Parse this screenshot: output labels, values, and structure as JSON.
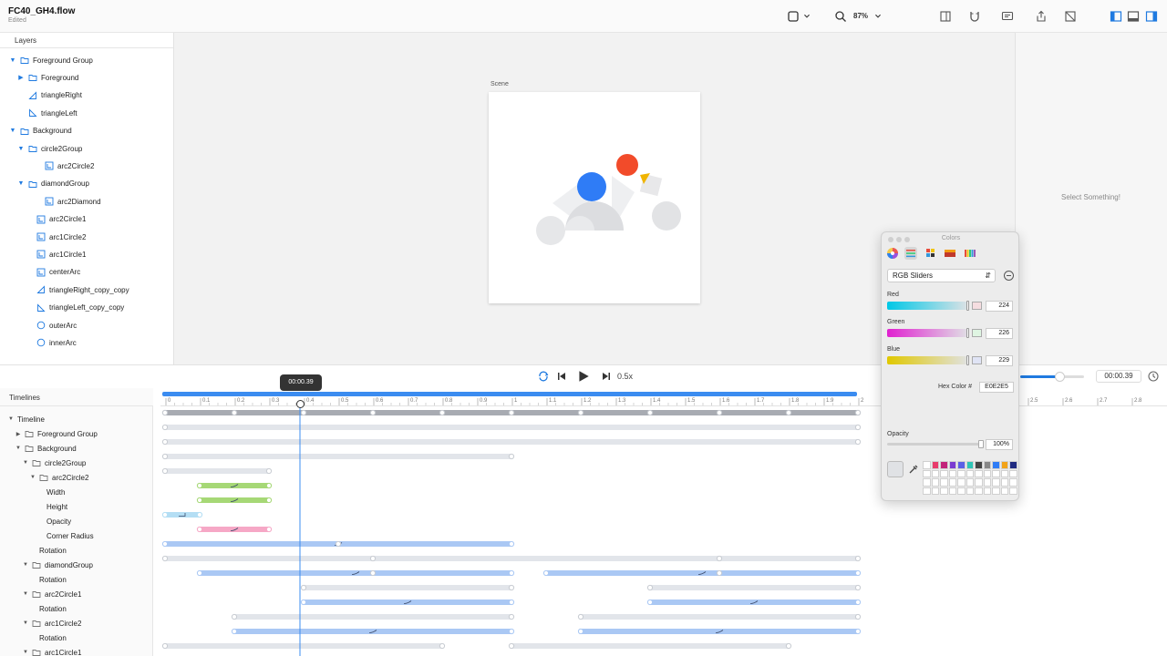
{
  "document": {
    "title": "FC40_GH4.flow",
    "status": "Edited"
  },
  "toolbar": {
    "zoom": "87%",
    "icons": [
      "square-icon",
      "chevron-down-icon",
      "search-icon",
      "chevron-down-icon",
      "sidebar-icon",
      "magnet-icon",
      "comment-icon",
      "share-icon",
      "image-icon",
      "left-panel-icon",
      "bottom-panel-icon",
      "right-panel-icon"
    ]
  },
  "layers": {
    "header": "Layers",
    "items": [
      {
        "label": "Foreground Group",
        "icon": "folder-icon",
        "expanded": true,
        "indent": 0
      },
      {
        "label": "Foreground",
        "icon": "folder-icon",
        "expanded": false,
        "indent": 1
      },
      {
        "label": "triangleRight",
        "icon": "triangle-right-icon",
        "expanded": null,
        "indent": 1
      },
      {
        "label": "triangleLeft",
        "icon": "triangle-left-icon",
        "expanded": null,
        "indent": 1
      },
      {
        "label": "Background",
        "icon": "folder-icon",
        "expanded": true,
        "indent": 0
      },
      {
        "label": "circle2Group",
        "icon": "folder-icon",
        "expanded": true,
        "indent": 1
      },
      {
        "label": "arc2Circle2",
        "icon": "arc-icon",
        "expanded": null,
        "indent": 3
      },
      {
        "label": "diamondGroup",
        "icon": "folder-icon",
        "expanded": true,
        "indent": 1
      },
      {
        "label": "arc2Diamond",
        "icon": "arc-icon",
        "expanded": null,
        "indent": 3
      },
      {
        "label": "arc2Circle1",
        "icon": "arc-icon",
        "expanded": null,
        "indent": 2
      },
      {
        "label": "arc1Circle2",
        "icon": "arc-icon",
        "expanded": null,
        "indent": 2
      },
      {
        "label": "arc1Circle1",
        "icon": "arc-icon",
        "expanded": null,
        "indent": 2
      },
      {
        "label": "centerArc",
        "icon": "arc-icon",
        "expanded": null,
        "indent": 2
      },
      {
        "label": "triangleRight_copy_copy",
        "icon": "triangle-right-icon",
        "expanded": null,
        "indent": 2
      },
      {
        "label": "triangleLeft_copy_copy",
        "icon": "triangle-left-icon",
        "expanded": null,
        "indent": 2
      },
      {
        "label": "outerArc",
        "icon": "circle-icon",
        "expanded": null,
        "indent": 2
      },
      {
        "label": "innerArc",
        "icon": "circle-icon",
        "expanded": null,
        "indent": 2
      }
    ]
  },
  "canvas": {
    "scene_label": "Scene"
  },
  "inspector": {
    "message": "Select Something!"
  },
  "timeline": {
    "header": "Timelines",
    "current_time": "00:00.39",
    "readout": "00:00.39",
    "speed": "0.5x",
    "ticks": [
      "0",
      "0.1",
      "0.2",
      "0.3",
      "0.4",
      "0.5",
      "0.6",
      "0.7",
      "0.8",
      "0.9",
      "1",
      "1.1",
      "1.2",
      "1.3",
      "1.4",
      "1.5",
      "1.6",
      "1.7",
      "1.8",
      "1.9",
      "2"
    ],
    "ticks_right": [
      "2.5",
      "2.6",
      "2.7",
      "2.8"
    ],
    "rows": [
      {
        "label": "Timeline",
        "expand": "open",
        "indent": 0
      },
      {
        "label": "Foreground Group",
        "expand": "closed",
        "indent": 1,
        "folder": true
      },
      {
        "label": "Background",
        "expand": "open",
        "indent": 1,
        "folder": true
      },
      {
        "label": "circle2Group",
        "expand": "open",
        "indent": 2,
        "folder": true
      },
      {
        "label": "arc2Circle2",
        "expand": "open",
        "indent": 3,
        "folder": true
      },
      {
        "label": "Width",
        "expand": "none",
        "indent": 4
      },
      {
        "label": "Height",
        "expand": "none",
        "indent": 4
      },
      {
        "label": "Opacity",
        "expand": "none",
        "indent": 4
      },
      {
        "label": "Corner Radius",
        "expand": "none",
        "indent": 4
      },
      {
        "label": "Rotation",
        "expand": "none",
        "indent": 3
      },
      {
        "label": "diamondGroup",
        "expand": "open",
        "indent": 2,
        "folder": true
      },
      {
        "label": "Rotation",
        "expand": "none",
        "indent": 3
      },
      {
        "label": "arc2Circle1",
        "expand": "open",
        "indent": 2,
        "folder": true
      },
      {
        "label": "Rotation",
        "expand": "none",
        "indent": 3
      },
      {
        "label": "arc1Circle2",
        "expand": "open",
        "indent": 2,
        "folder": true
      },
      {
        "label": "Rotation",
        "expand": "none",
        "indent": 3
      },
      {
        "label": "arc1Circle1",
        "expand": "open",
        "indent": 2,
        "folder": true
      }
    ]
  },
  "colors_panel": {
    "title": "Colors",
    "mode": "RGB Sliders",
    "red": {
      "label": "Red",
      "value": "224"
    },
    "green": {
      "label": "Green",
      "value": "226"
    },
    "blue": {
      "label": "Blue",
      "value": "229"
    },
    "hex_label": "Hex Color #",
    "hex_value": "E0E2E5",
    "opacity_label": "Opacity",
    "opacity_value": "100%",
    "swatches": [
      "#ffffff",
      "#e83b6c",
      "#c2237a",
      "#7a3bd1",
      "#5b5fe6",
      "#2ec4b6",
      "#444444",
      "#888888",
      "#2f7cf6",
      "#f2a318",
      "#1f2a80"
    ]
  }
}
